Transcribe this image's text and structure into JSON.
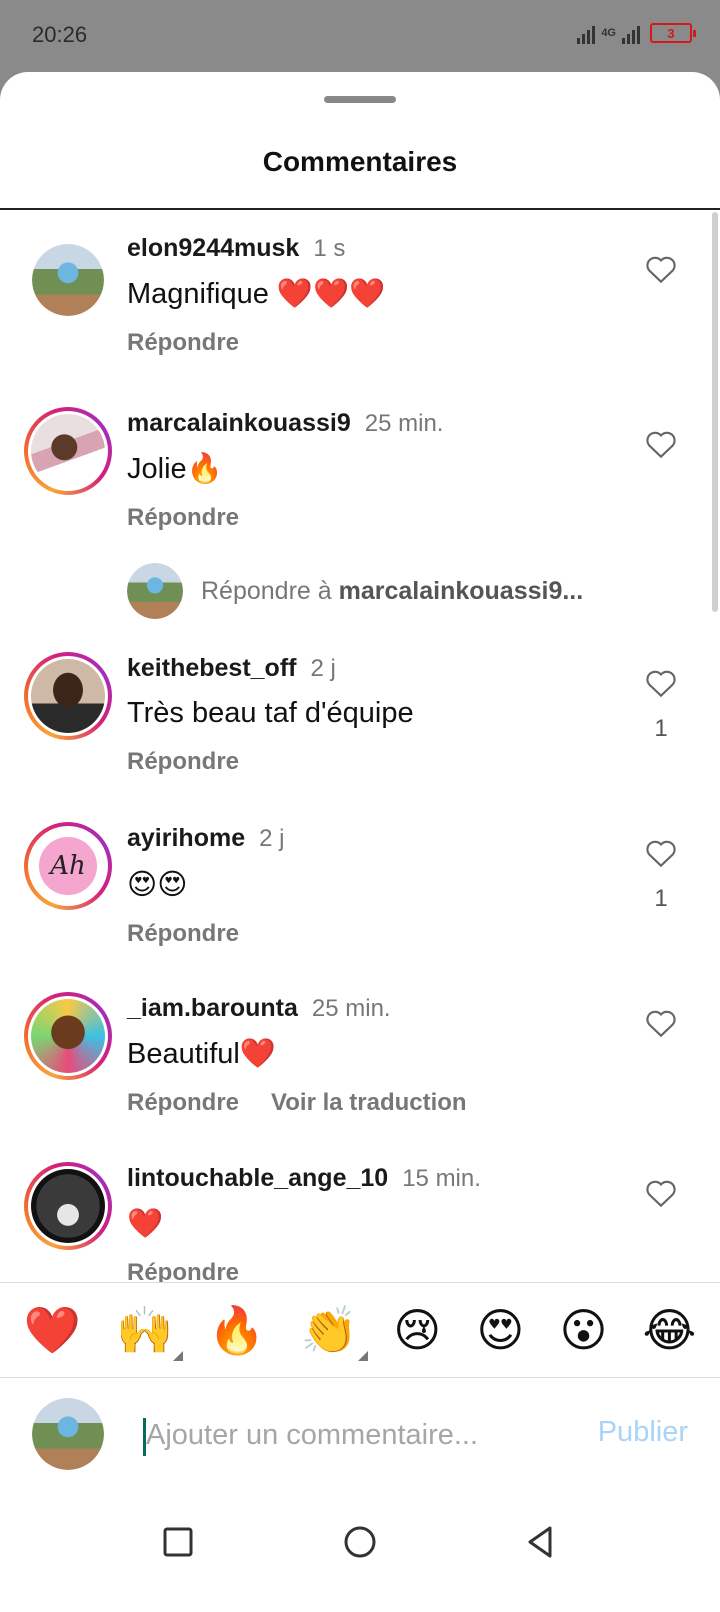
{
  "status": {
    "time": "20:26",
    "network": "4G",
    "battery": "3"
  },
  "sheet": {
    "title": "Commentaires"
  },
  "comments": [
    {
      "user": "elon9244musk",
      "time": "1 s",
      "text": "Magnifique ❤️❤️❤️",
      "reply": "Répondre",
      "likes": ""
    },
    {
      "user": "marcalainkouassi9",
      "time": "25 min.",
      "text": "Jolie🔥",
      "reply": "Répondre",
      "likes": ""
    },
    {
      "user": "keithebest_off",
      "time": "2 j",
      "text": "Très beau taf d'équipe",
      "reply": "Répondre",
      "likes": "1"
    },
    {
      "user": "ayirihome",
      "time": "2 j",
      "text": "😍😍",
      "reply": "Répondre",
      "likes": "1"
    },
    {
      "user": "_iam.barounta",
      "time": "25 min.",
      "text": "Beautiful❤️",
      "reply": "Répondre",
      "translate": "Voir la traduction",
      "likes": ""
    },
    {
      "user": "lintouchable_ange_10",
      "time": "15 min.",
      "text": "❤️",
      "reply": "Répondre",
      "likes": ""
    }
  ],
  "reply_prompt": {
    "prefix": "Répondre à ",
    "user": "marcalainkouassi9..."
  },
  "logo_text": "Ah",
  "emoji_bar": [
    "❤️",
    "🙌",
    "🔥",
    "👏",
    "😢",
    "😍",
    "😮",
    "😂"
  ],
  "input": {
    "placeholder": "Ajouter un commentaire...",
    "publish": "Publier"
  },
  "colors": {
    "accent_light": "#a9d3f7",
    "battery_red": "#d21a1a"
  },
  "nav": {
    "icons": [
      "square-icon",
      "circle-icon",
      "triangle-back-icon"
    ]
  }
}
